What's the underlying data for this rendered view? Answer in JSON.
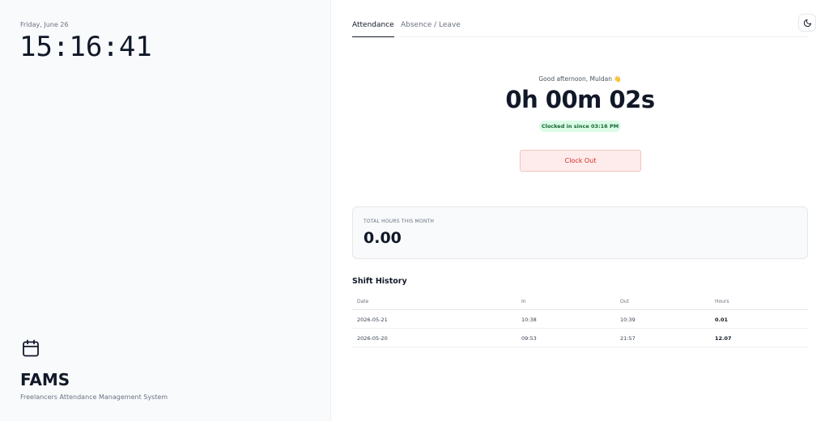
{
  "left": {
    "date": "Friday, June 26",
    "clock": "15:16:41",
    "brand": {
      "icon": "calendar-icon",
      "name": "FAMS",
      "subtitle": "Freelancers Attendance Management System"
    }
  },
  "tabs": [
    {
      "label": "Attendance",
      "active": true
    },
    {
      "label": "Absence / Leave",
      "active": false
    }
  ],
  "theme_toggle": {
    "icon": "moon-icon"
  },
  "attendance": {
    "greeting": "Good afternoon, Muldan 👋",
    "elapsed": "0h 00m 02s",
    "status": "Clocked in since 03:16 PM",
    "clock_out_label": "Clock Out"
  },
  "summary": {
    "label": "TOTAL HOURS THIS MONTH",
    "value": "0.00"
  },
  "shift_history": {
    "title": "Shift History",
    "columns": [
      "Date",
      "In",
      "Out",
      "Hours"
    ],
    "rows": [
      {
        "date": "2026-05-21",
        "in": "10:38",
        "out": "10:39",
        "hours": "0.01"
      },
      {
        "date": "2026-05-20",
        "in": "09:53",
        "out": "21:57",
        "hours": "12.07"
      }
    ]
  },
  "colors": {
    "accent": "#111827",
    "status_green_bg": "#dcfce7",
    "status_green_text": "#166534",
    "danger_bg": "#fdeceb",
    "danger_text": "#dc2626"
  }
}
